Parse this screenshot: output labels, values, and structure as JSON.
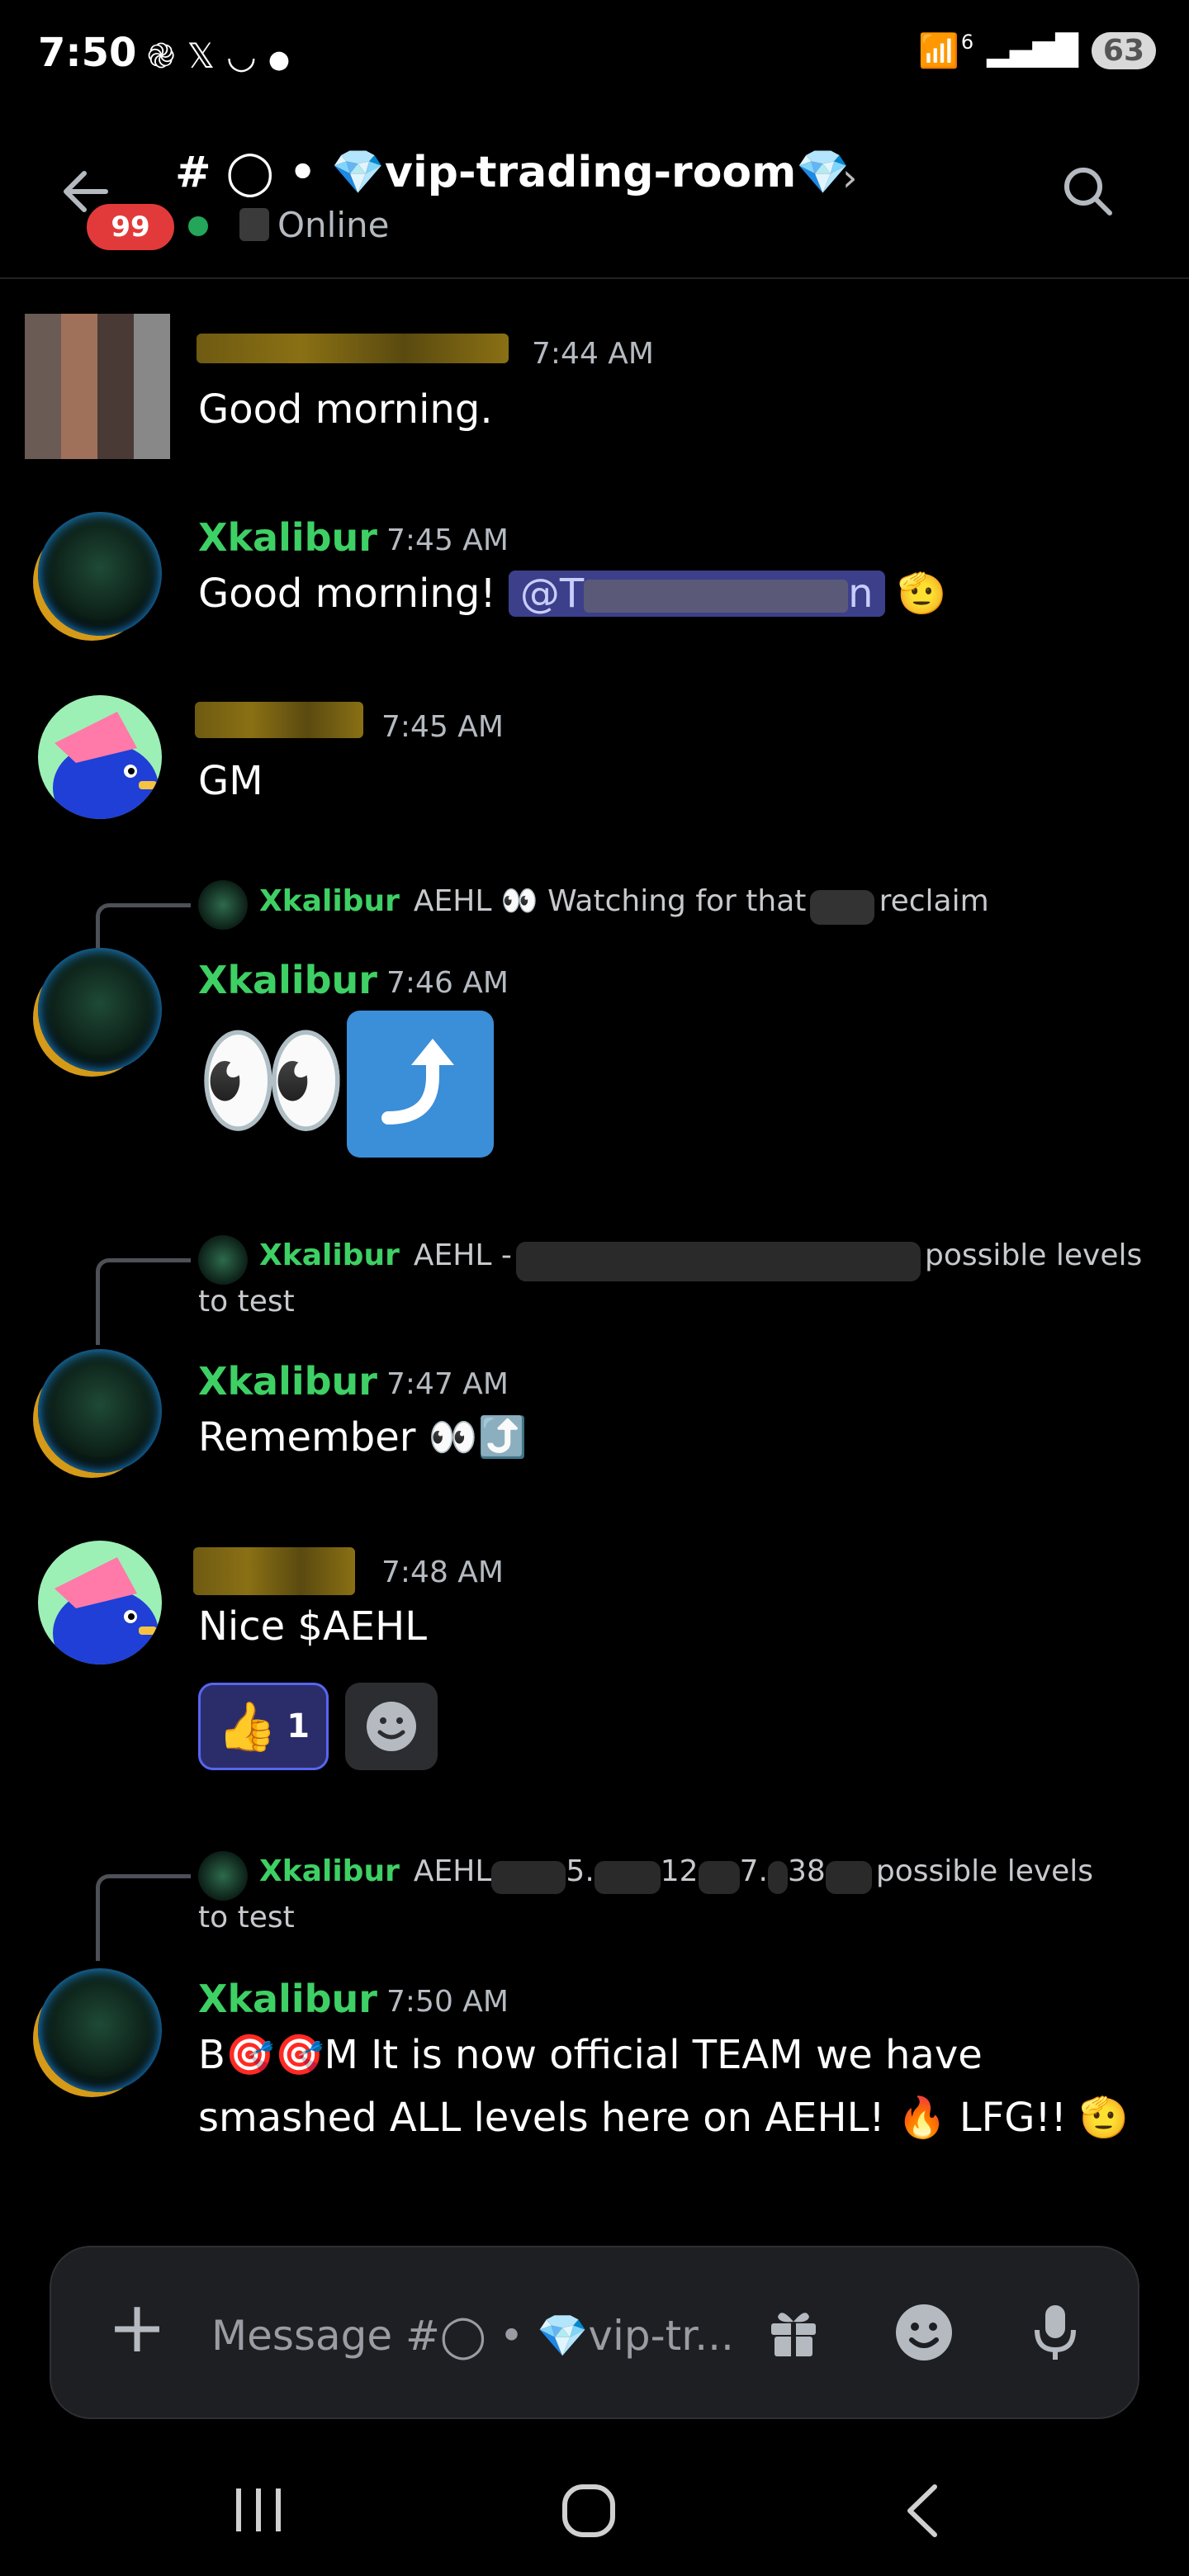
{
  "status_bar": {
    "time": "7:50",
    "icons": [
      "openai-icon",
      "x-icon",
      "smile-icon",
      "dot-icon"
    ],
    "network_label": "6",
    "battery": "63"
  },
  "header": {
    "unread_badge": "99",
    "channel_title": "# ◯ • 💎vip-trading-room💎",
    "status": "Online"
  },
  "messages": [
    {
      "time": "7:44 AM",
      "text": "Good morning."
    },
    {
      "author": "Xkalibur",
      "time": "7:45 AM",
      "text": "Good morning!",
      "mention": "@T",
      "mention_end": "n",
      "emoji": "🫡"
    },
    {
      "time": "7:45 AM",
      "text": "GM"
    },
    {
      "reply": {
        "author": "Xkalibur",
        "text_a": "AEHL 👀 Watching for that",
        "text_b": "reclaim"
      },
      "author": "Xkalibur",
      "time": "7:46 AM",
      "emoji_eyes": "👀"
    },
    {
      "reply": {
        "author": "Xkalibur",
        "text_a": "AEHL -",
        "text_b": "possible levels",
        "text_c": "to test"
      },
      "author": "Xkalibur",
      "time": "7:47 AM",
      "text": "Remember 👀⤴️"
    },
    {
      "time": "7:48 AM",
      "text": "Nice $AEHL",
      "reaction": {
        "emoji": "👍",
        "count": "1"
      }
    },
    {
      "reply": {
        "author": "Xkalibur",
        "text_a": "AEHL",
        "text_mid1": "5.",
        "text_mid2": "12",
        "text_mid3": "7.",
        "text_mid4": "38",
        "text_b": "possible levels",
        "text_c": "to test"
      },
      "author": "Xkalibur",
      "time": "7:50 AM",
      "line1": "B🎯🎯M It is now official TEAM we have",
      "line2": "smashed ALL levels here on AEHL! 🔥 LFG!! 🫡"
    }
  ],
  "composer": {
    "placeholder": "Message #◯ • 💎vip-tr..."
  },
  "colors": {
    "username": "#3ed064",
    "badge": "#e23a3a",
    "online": "#23a55a",
    "reaction_border": "#5865f2"
  }
}
